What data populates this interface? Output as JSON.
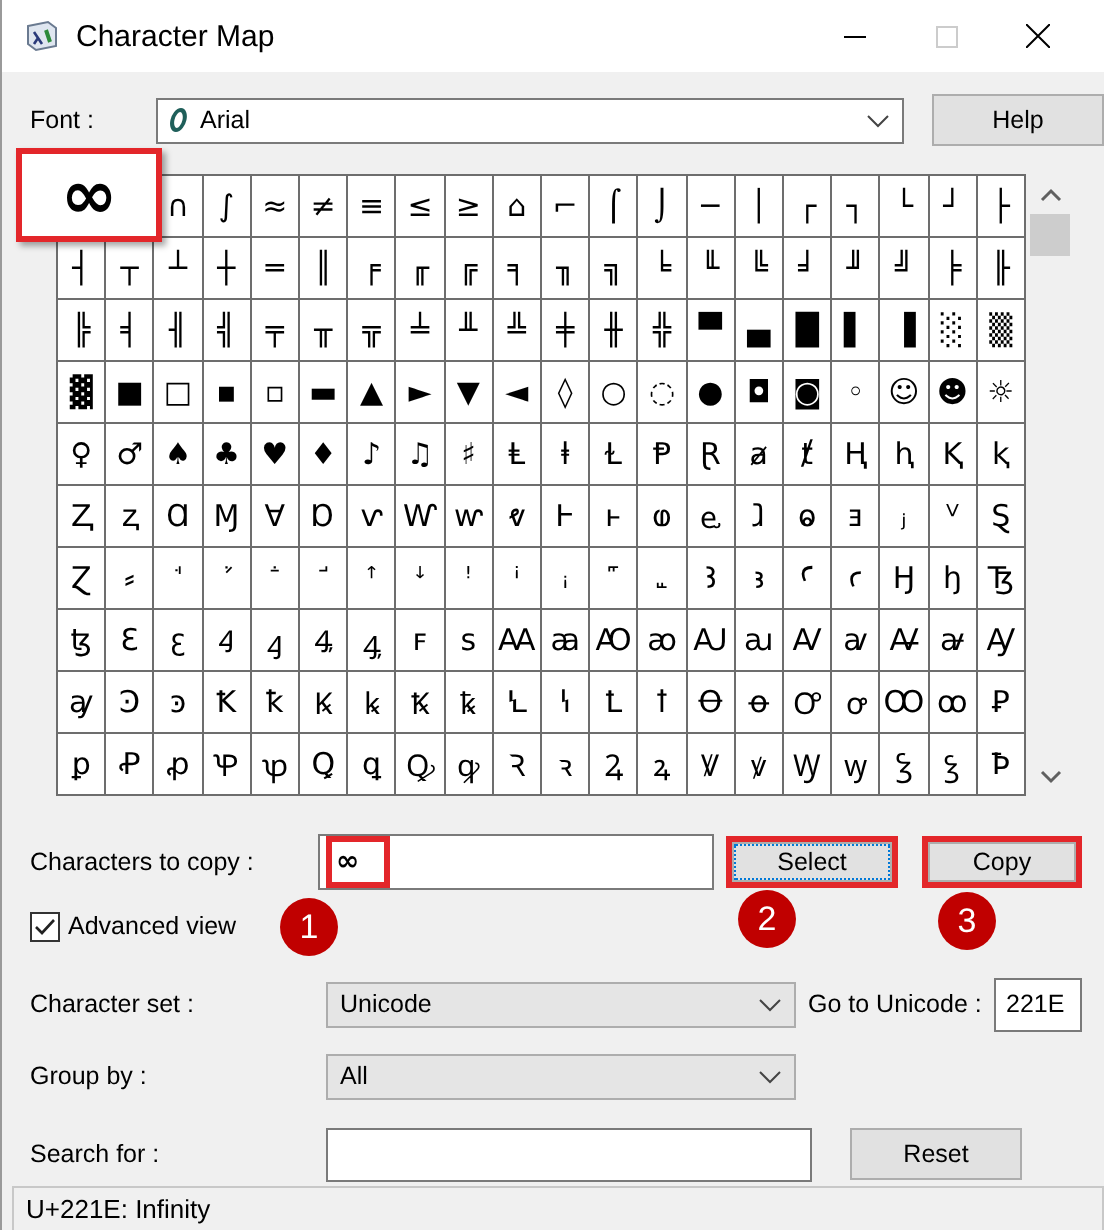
{
  "window": {
    "title": "Character Map"
  },
  "font": {
    "label": "Font :",
    "value": "Arial",
    "button": "Help"
  },
  "grid": {
    "magnified": {
      "char": "∞",
      "highlighted": true
    },
    "rows": [
      [
        "",
        "",
        "∩",
        "∫",
        "≈",
        "≠",
        "≡",
        "≤",
        "≥",
        "⌂",
        "⌐",
        "⌠",
        "⌡",
        "─",
        "│",
        "┌",
        "┐",
        "└",
        "┘",
        "├"
      ],
      [
        "┤",
        "┬",
        "┴",
        "┼",
        "═",
        "║",
        "╒",
        "╓",
        "╔",
        "╕",
        "╖",
        "╗",
        "╘",
        "╙",
        "╚",
        "╛",
        "╜",
        "╝",
        "╞",
        "╟"
      ],
      [
        "╠",
        "╡",
        "╢",
        "╣",
        "╤",
        "╥",
        "╦",
        "╧",
        "╨",
        "╩",
        "╪",
        "╫",
        "╬",
        "▀",
        "▄",
        "█",
        "▌",
        "▐",
        "░",
        "▒"
      ],
      [
        "▓",
        "■",
        "□",
        "▪",
        "▫",
        "▬",
        "▲",
        "►",
        "▼",
        "◄",
        "◊",
        "○",
        "◌",
        "●",
        "◘",
        "◙",
        "◦",
        "☺",
        "☻",
        "☼"
      ],
      [
        "♀",
        "♂",
        "♠",
        "♣",
        "♥",
        "♦",
        "♪",
        "♫",
        "♯",
        "Ⱡ",
        "ⱡ",
        "Ɫ",
        "Ᵽ",
        "Ɽ",
        "ⱥ",
        "ⱦ",
        "Ⱨ",
        "ⱨ",
        "Ⱪ",
        "ⱪ"
      ],
      [
        "Ⱬ",
        "ⱬ",
        "Ɑ",
        "Ɱ",
        "Ɐ",
        "Ɒ",
        "ⱱ",
        "Ⱳ",
        "ⱳ",
        "ⱴ",
        "Ⱶ",
        "ⱶ",
        "ⱷ",
        "ⱸ",
        "ⱹ",
        "ⱺ",
        "ⱻ",
        "ⱼ",
        "ⱽ",
        "Ȿ"
      ],
      [
        "Ɀ",
        "⸗",
        "ꜗ",
        "ꜘ",
        "ꜙ",
        "ꜚ",
        "ꜛ",
        "ꜜ",
        "ꜝ",
        "ꜞ",
        "ꜟ",
        "꜠",
        "꜡",
        "Ꜣ",
        "ꜣ",
        "Ꜥ",
        "ꜥ",
        "Ꜧ",
        "ꜧ",
        "Ꜩ"
      ],
      [
        "ꜩ",
        "Ꜫ",
        "ꜫ",
        "Ꜭ",
        "ꜭ",
        "Ꜯ",
        "ꜯ",
        "ꜰ",
        "ꜱ",
        "Ꜳ",
        "ꜳ",
        "Ꜵ",
        "ꜵ",
        "Ꜷ",
        "ꜷ",
        "Ꜹ",
        "ꜹ",
        "Ꜻ",
        "ꜻ",
        "Ꜽ"
      ],
      [
        "ꜽ",
        "Ꜿ",
        "ꜿ",
        "Ꝁ",
        "ꝁ",
        "Ꝃ",
        "ꝃ",
        "Ꝅ",
        "ꝅ",
        "Ꝇ",
        "ꝇ",
        "Ꝉ",
        "ꝉ",
        "Ꝋ",
        "ꝋ",
        "Ꝍ",
        "ꝍ",
        "Ꝏ",
        "ꝏ",
        "Ꝑ"
      ],
      [
        "ꝑ",
        "Ꝓ",
        "ꝓ",
        "Ꝕ",
        "ꝕ",
        "Ꝗ",
        "ꝗ",
        "Ꝙ",
        "ꝙ",
        "Ꝛ",
        "ꝛ",
        "Ꝝ",
        "ꝝ",
        "Ꝟ",
        "ꝟ",
        "Ꝡ",
        "ꝡ",
        "Ꝣ",
        "ꝣ",
        "Ꝥ"
      ]
    ]
  },
  "copy_row": {
    "label": "Characters to copy :",
    "value": "∞",
    "highlighted": true,
    "select_button": {
      "label": "Select",
      "highlighted": true,
      "focused": true
    },
    "copy_button": {
      "label": "Copy",
      "highlighted": true,
      "focused": false
    }
  },
  "advanced_view": {
    "label": "Advanced view",
    "checked": true
  },
  "character_set": {
    "label": "Character set :",
    "value": "Unicode"
  },
  "go_to_unicode": {
    "label": "Go to Unicode :",
    "value": "221E"
  },
  "group_by": {
    "label": "Group by :",
    "value": "All"
  },
  "search": {
    "label": "Search for :",
    "button": "Reset"
  },
  "status_bar": "U+221E: Infinity",
  "callouts": [
    {
      "label": "1"
    },
    {
      "label": "2"
    },
    {
      "label": "3"
    }
  ]
}
